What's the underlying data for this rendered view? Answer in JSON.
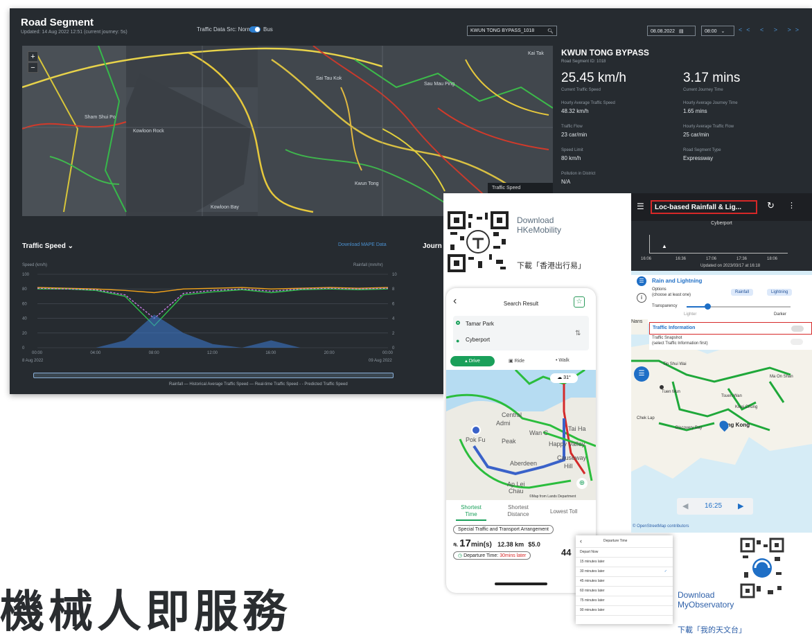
{
  "dashboard": {
    "title": "Road Segment",
    "updated": "Updated: 14 Aug 2022 12:51 (current journey: 5s)",
    "toggle_label": "Traffic Data Src: Normal",
    "toggle_bus": "Bus",
    "search_value": "KWUN TONG BYPASS_1018",
    "date_value": "08.08.2022",
    "time_value": "08:00",
    "nav_buttons": "<< < > >>",
    "map": {
      "labels": [
        "Sham Shui Po",
        "Kowloon Rock",
        "Kwun Tong",
        "Kowloon Bay",
        "Sai Tau Kok",
        "Sau Mau Ping",
        "Kai Tak"
      ],
      "speed_legend": "Traffic Speed"
    },
    "info": {
      "road_name": "KWUN TONG BYPASS",
      "road_segment": "Road Segment ID: 1018",
      "speed_value": "25.45 km/h",
      "speed_caption": "Current Traffic Speed",
      "journey_value": "3.17 mins",
      "journey_caption": "Current Journey Time",
      "hourly_speed_caption": "Hourly Average Traffic Speed",
      "hourly_speed_value": "48.32 km/h",
      "hourly_journey_caption": "Hourly Average Journey Time",
      "hourly_journey_value": "1.65 mins",
      "flow_caption": "Traffic Flow",
      "flow_value": "23 car/min",
      "hourly_flow_caption": "Hourly Average Traffic Flow",
      "hourly_flow_value": "25 car/min",
      "limit_caption": "Speed Limit",
      "limit_value": "80 km/h",
      "type_caption": "Road Segment Type",
      "type_value": "Expressway",
      "pollution_caption": "Pollution in District",
      "pollution_value": "N/A"
    },
    "speed_panel": {
      "title": "Traffic Speed",
      "download": "Download MAPE Data",
      "y_left_label": "Speed (km/h)",
      "y_right_label": "Rainfall (mm/hr)",
      "date_left": "8 Aug 2022",
      "date_right": "09 Aug 2022"
    },
    "panel2_title": "Journ",
    "legend": "Rainfall  — Historical Average Traffic Speed  — Real-time Traffic Speed  - - Predicted Traffic Speed"
  },
  "chart_data": {
    "type": "line",
    "x": [
      "00:00",
      "04:00",
      "08:00",
      "12:00",
      "16:00",
      "20:00",
      "00:00"
    ],
    "ylim": [
      0,
      100
    ],
    "y2lim": [
      0,
      10
    ],
    "y_ticks": [
      "0",
      "20",
      "40",
      "60",
      "80",
      "100"
    ],
    "y2_ticks": [
      "0",
      "2",
      "4",
      "6",
      "8",
      "10"
    ],
    "series": [
      {
        "name": "Historical Average Traffic Speed",
        "color": "#f2a31b",
        "values": [
          82,
          81,
          80,
          78,
          75,
          80,
          81,
          82,
          80,
          81,
          82,
          81,
          82
        ]
      },
      {
        "name": "Real-time Traffic Speed",
        "color": "#2ec24a",
        "values": [
          80,
          80,
          78,
          70,
          30,
          72,
          76,
          79,
          75,
          79,
          80,
          79,
          80
        ]
      },
      {
        "name": "Predicted Traffic Speed",
        "color": "#c47be0",
        "values": [
          81,
          80,
          79,
          72,
          40,
          74,
          78,
          80,
          77,
          80,
          81,
          80,
          81
        ]
      },
      {
        "name": "Rainfall",
        "color": "#3d7bd6",
        "values": [
          0,
          0,
          0,
          1,
          4.5,
          2,
          0.5,
          0,
          1,
          0,
          0,
          0,
          0
        ]
      }
    ]
  },
  "hkemobility": {
    "download_line1": "Download",
    "download_line2": "HKeMobility",
    "download_zh": "下載「香港出行易」",
    "search_title": "Search Result",
    "from": "Tamar Park",
    "to": "Cyberport",
    "modes": [
      "Drive",
      "Ride",
      "Walk"
    ],
    "temp": "31°",
    "map_labels": [
      "Central",
      "Admi",
      "Wan C",
      "Tai Ha",
      "Pok Fu",
      "Peak",
      "Happy Valley",
      "Aberdeen",
      "Causeway",
      "Hill",
      "Ap Lei",
      "Chau"
    ],
    "tabs": [
      "Shortest Time",
      "Shortest Distance",
      "Lowest Toll"
    ],
    "special": "Special Traffic and Transport Arrangement",
    "duration": "17",
    "duration_unit": "min(s)",
    "distance": "12.38 km",
    "cost": "$5.0",
    "departure_label": "Departure Time:",
    "departure_value": "30mins later",
    "partial_value": "44",
    "credit": "©Map from Lands Department"
  },
  "departure": {
    "title": "Departure Time",
    "options": [
      "Depart Now",
      "15 minutes later",
      "30 minutes later",
      "45 minutes later",
      "60 minutes later",
      "75 minutes later",
      "90 minutes later"
    ],
    "selected_index": 2
  },
  "myobservatory": {
    "header_title": "Loc-based Rainfall & Lig...",
    "location": "Cyberport",
    "timeline": [
      "16:06",
      "16:36",
      "17:06",
      "17:36",
      "18:06"
    ],
    "updated": "Updated on 2023/03/17 at 16:18",
    "rain_title": "Rain and Lightning",
    "options_label": "Options",
    "options_hint": "(choose at least one)",
    "chip_rainfall": "Rainfall",
    "chip_lightning": "Lightning",
    "transparency": "Transparency",
    "lighter": "Lighter",
    "darker": "Darker",
    "traffic_info": "Traffic Information",
    "snapshot": "Traffic Snapshot",
    "snapshot_hint": "(select Traffic Information first)",
    "map_labels": [
      "Nans",
      "Tin Shui Wai",
      "Ma On Shan",
      "Tuen Mun",
      "Tsuen Wan",
      "Kwai Chung",
      "Chek Lap",
      "Discovery Bay",
      "Hong Kong"
    ],
    "play_time": "16:25",
    "osm": "© OpenStreetMap contributors",
    "download_line1": "Download",
    "download_line2": "MyObservatory",
    "download_zh": "下載「我的天文台」"
  },
  "big_title": "機械人即服務",
  "colors": {
    "dashboard_bg": "#262b30",
    "accent_blue": "#2d7fd0",
    "drive_green": "#1aa05a",
    "highlight_red": "#d62828",
    "hko_blue": "#1f6fc6"
  }
}
